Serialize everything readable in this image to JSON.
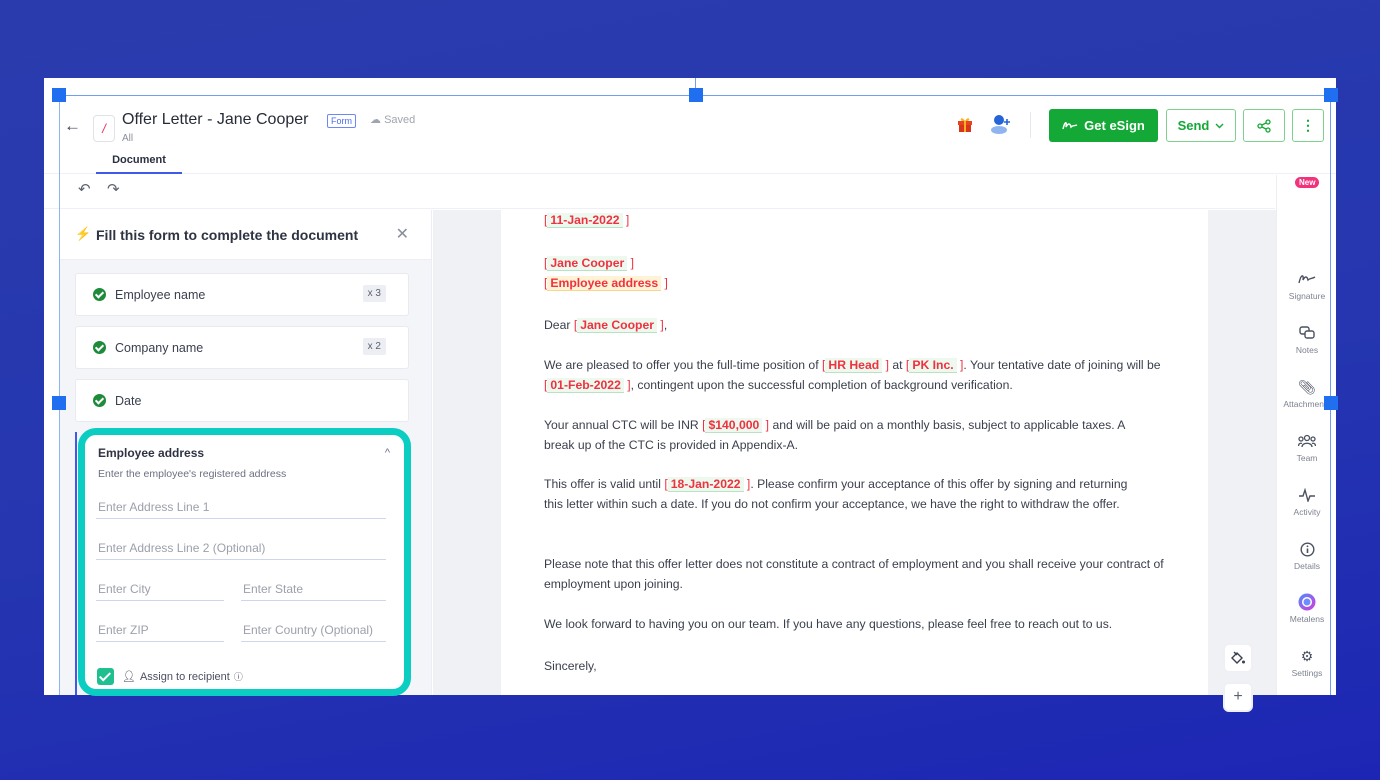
{
  "header": {
    "back_label": "←",
    "title": "Offer Letter - Jane Cooper",
    "form_badge": "Form",
    "saved_status": "Saved",
    "folder": "All",
    "tabs": [
      {
        "label": "Document",
        "active": true
      }
    ],
    "esign_label": "Get eSign",
    "send_label": "Send"
  },
  "toolbar": {
    "undo": "↶",
    "redo": "↷"
  },
  "form_panel": {
    "title": "Fill this form to complete the document",
    "fields": [
      {
        "label": "Employee name",
        "count": "x 3",
        "status": "complete"
      },
      {
        "label": "Company name",
        "count": "x 2",
        "status": "complete"
      },
      {
        "label": "Date",
        "count": "",
        "status": "complete"
      }
    ],
    "address": {
      "title": "Employee address",
      "description": "Enter the employee's registered address",
      "line1_placeholder": "Enter Address Line 1",
      "line2_placeholder": "Enter Address Line 2 (Optional)",
      "city_placeholder": "Enter City",
      "state_placeholder": "Enter State",
      "zip_placeholder": "Enter ZIP",
      "country_placeholder": "Enter Country (Optional)",
      "assign_label": "Assign to recipient",
      "assign_checked": true
    },
    "highlight_color": "#0bcdc2"
  },
  "document": {
    "date": "11-Jan-2022",
    "employee_name": "Jane Cooper",
    "employee_address": "Employee address",
    "greeting_prefix": "Dear",
    "p1_a": "We are pleased to offer you the full-time position of",
    "position": "HR Head",
    "p1_b": "at",
    "company": "PK Inc.",
    "p1_c": ". Your tentative date of joining will be",
    "joining_date": "01-Feb-2022",
    "p1_d": ", contingent upon the successful completion of background verification.",
    "p2_a": "Your annual CTC will be INR",
    "ctc": "$140,000",
    "p2_b": "and will be paid on a monthly basis, subject to applicable taxes. A break up of the CTC is provided in Appendix-A.",
    "p3_a": "This offer is valid until",
    "valid_until": "18-Jan-2022",
    "p3_b": ". Please confirm your acceptance of this offer by signing and returning this letter within such a date. If you do not confirm your acceptance, we have the right to withdraw the offer.",
    "p4": "Please note that this offer letter does not constitute a contract of employment and you shall receive your contract of employment upon joining.",
    "p5": "We look forward to having you on our team. If you have any questions, please feel free to reach out to us.",
    "closing": "Sincerely,"
  },
  "rail": {
    "new_badge": "New",
    "items": [
      {
        "label": "Signature",
        "icon": "signature-icon"
      },
      {
        "label": "Notes",
        "icon": "notes-icon"
      },
      {
        "label": "Attachments",
        "icon": "paperclip-icon"
      },
      {
        "label": "Team",
        "icon": "team-icon"
      },
      {
        "label": "Activity",
        "icon": "activity-icon"
      },
      {
        "label": "Details",
        "icon": "info-icon"
      },
      {
        "label": "Metalens",
        "icon": "metalens-icon"
      },
      {
        "label": "Settings",
        "icon": "gear-icon"
      }
    ]
  },
  "colors": {
    "brand_green": "#14a836",
    "accent_blue": "#3f5ae8",
    "placeholder_red": "#f0313f",
    "new_badge": "#f2337b"
  }
}
